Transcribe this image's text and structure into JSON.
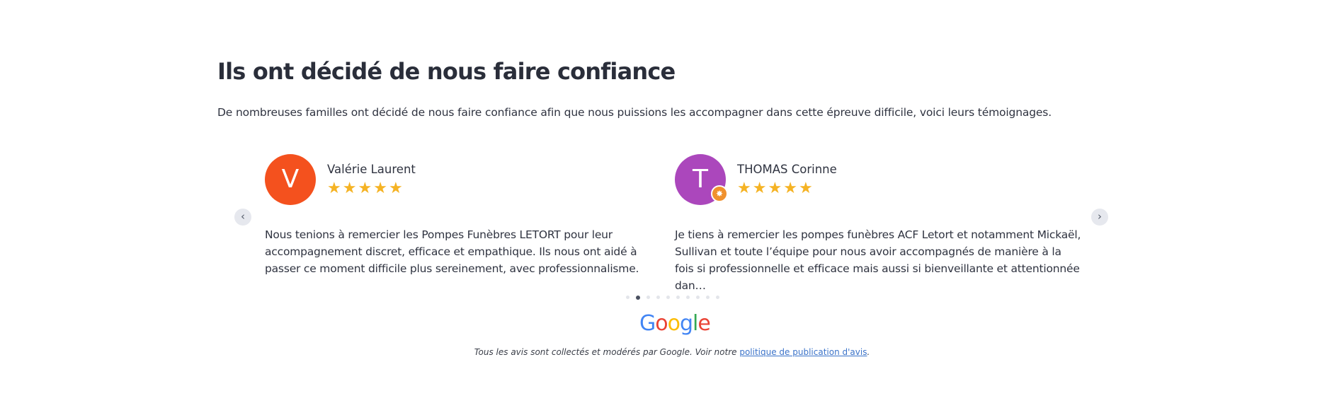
{
  "section": {
    "title": "Ils ont décidé de nous faire confiance",
    "intro": "De nombreuses familles ont décidé de nous faire confiance afin que nous puissions les accompagner dans cette épreuve difficile, voici leurs témoignages."
  },
  "carousel": {
    "prev_icon": "‹",
    "next_icon": "›",
    "page_count": 10,
    "active_page": 2
  },
  "reviews": [
    {
      "initial": "V",
      "avatar_color": "#f4511e",
      "name": "Valérie Laurent",
      "rating": 5,
      "text": "Nous tenions à remercier les Pompes Funèbres LETORT pour leur accompagnement discret, efficace et empathique. Ils nous ont aidé à passer ce moment difficile plus sereinement, avec professionnalisme."
    },
    {
      "initial": "T",
      "avatar_color": "#ab47bc",
      "badge_icon": "local-guide-star-icon",
      "name": "THOMAS Corinne",
      "rating": 5,
      "text": "Je tiens à remercier les pompes funèbres ACF Letort et notamment Mickaël, Sullivan et toute l’équipe pour nous avoir accompagnés de manière à la fois si professionnelle et efficace mais aussi si bienveillante et attentionnée dan…"
    }
  ],
  "google": {
    "letters": [
      "G",
      "o",
      "o",
      "g",
      "l",
      "e"
    ]
  },
  "footer": {
    "text": "Tous les avis sont collectés et modérés par Google. Voir notre ",
    "link": "politique de publication d'avis",
    "end": "."
  }
}
